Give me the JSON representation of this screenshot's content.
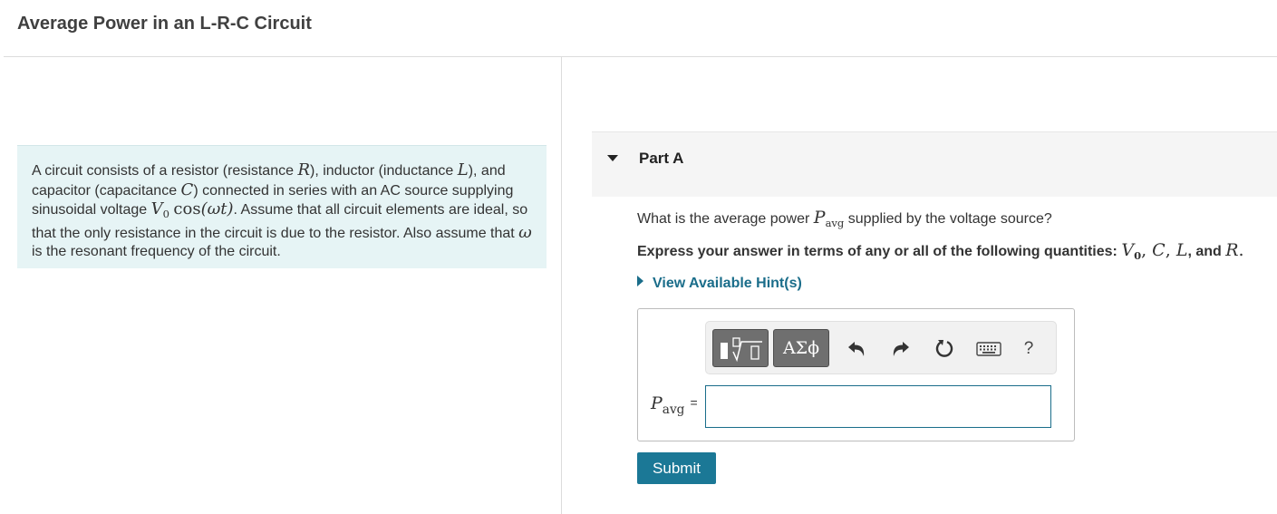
{
  "header": {
    "title": "Average Power in an L-R-C Circuit"
  },
  "problem": {
    "t1": "A circuit consists of a resistor (resistance ",
    "v_R": "R",
    "t2": "), inductor (inductance ",
    "v_L": "L",
    "t3": "), and capacitor (capacitance ",
    "v_C": "C",
    "t4": ") connected in series with an AC source supplying sinusoidal voltage ",
    "v_V": "V",
    "v_sub0": "0",
    "f_cos": "cos",
    "v_arg": "(ωt)",
    "t5": ". Assume that all circuit elements are ideal, so that the only resistance in the circuit is due to the resistor. Also assume that ",
    "v_omega": "ω",
    "t6": " is the resonant frequency of the circuit."
  },
  "part": {
    "label": "Part A"
  },
  "question": {
    "q1": "What is the average power ",
    "p": "P",
    "p_sub": "avg",
    "q2": " supplied by the voltage source?"
  },
  "instruction": {
    "i1": "Express your answer in terms of any or all of the following quantities: ",
    "vars": {
      "V": "V",
      "V_sub": "0",
      "sep1": ", ",
      "C": "C",
      "sep2": ", ",
      "L": "L",
      "sep3": ", and ",
      "R": "R",
      "end": "."
    }
  },
  "hint": {
    "label": "View Available Hint(s)"
  },
  "toolbar": {
    "symbols_label": "ΑΣϕ",
    "help_label": "?",
    "icons": [
      "templates-icon",
      "undo-icon",
      "redo-icon",
      "reset-icon",
      "keyboard-icon",
      "help-icon"
    ]
  },
  "answer": {
    "label_var": "P",
    "label_sub": "avg",
    "label_eq": "=",
    "value": ""
  },
  "submit": {
    "label": "Submit"
  },
  "colors": {
    "problem_bg": "#e6f4f5",
    "accent": "#1a6d8a",
    "submit_bg": "#1b7896",
    "tool_dark": "#6f6f6f"
  }
}
